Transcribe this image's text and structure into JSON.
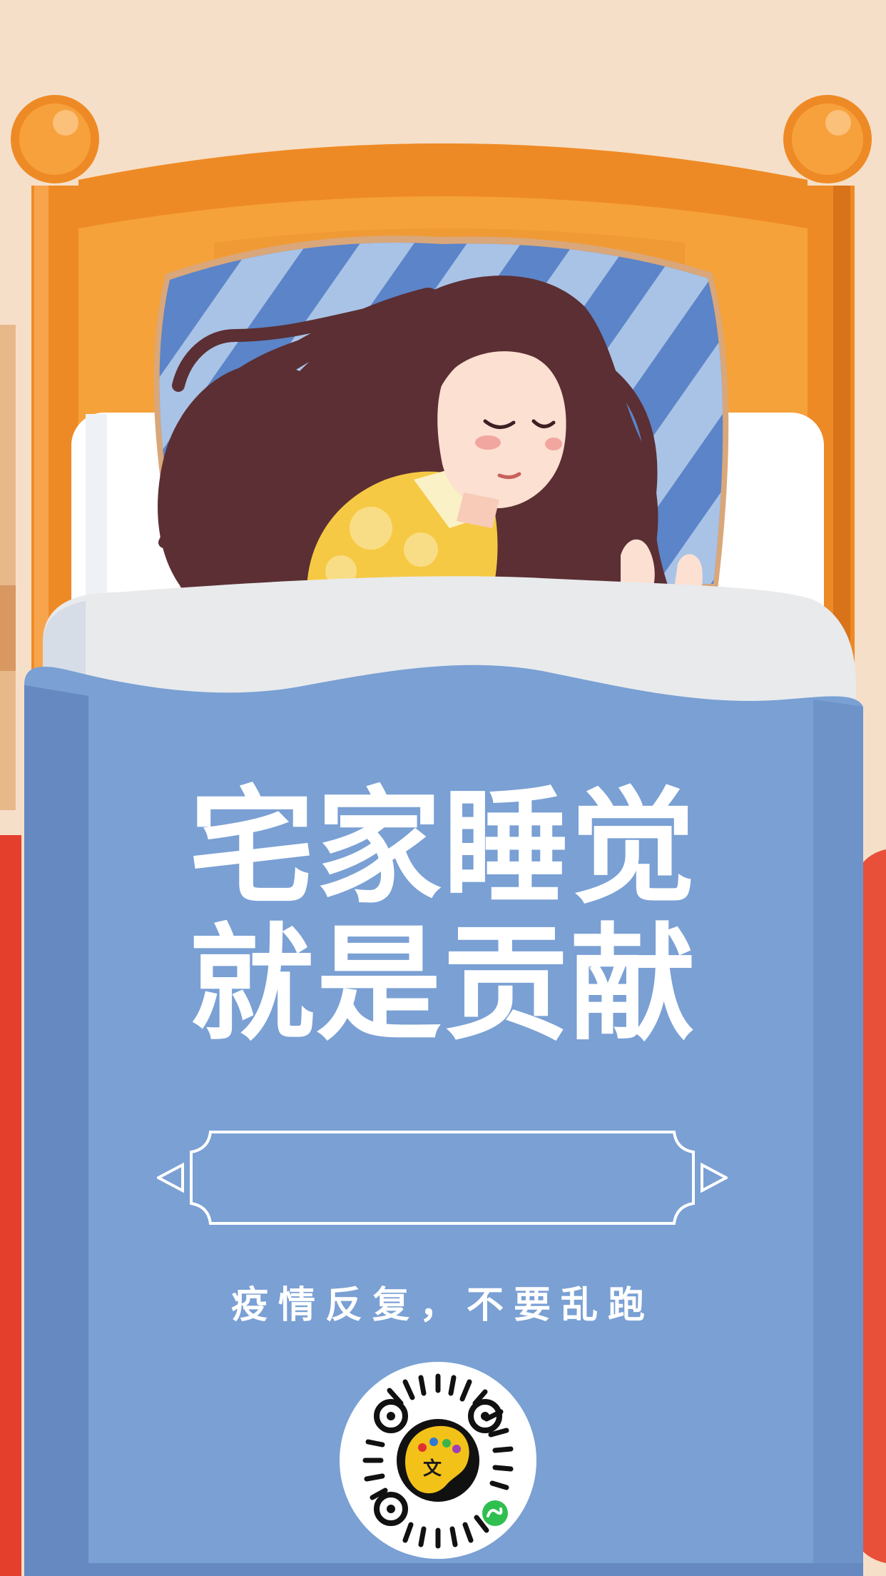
{
  "poster": {
    "headline_line1": "宅家睡觉",
    "headline_line2": "就是贡献",
    "tagline": "疫情反复，不要乱跑",
    "qr_logo_char": "文"
  },
  "colors": {
    "background": "#f6dfc8",
    "bed_frame": "#f1932c",
    "blanket": "#7aa0d4",
    "hair": "#5b2f33",
    "side_accent": "#e8503a"
  }
}
